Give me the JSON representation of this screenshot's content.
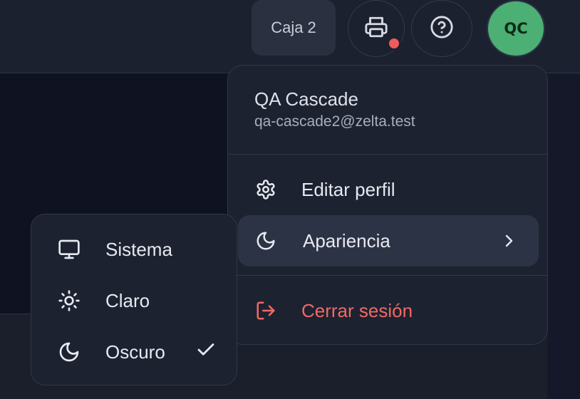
{
  "header": {
    "register_label": "Caja 2",
    "avatar_initials": "QC",
    "printer_status_color": "#ef5b5b",
    "avatar_color": "#4caf74"
  },
  "menu": {
    "user_name": "QA Cascade",
    "user_email": "qa-cascade2@zelta.test",
    "items": {
      "edit_profile": "Editar perfil",
      "appearance": "Apariencia",
      "logout": "Cerrar sesión"
    }
  },
  "appearance_submenu": {
    "options": [
      "Sistema",
      "Claro",
      "Oscuro"
    ],
    "selected": "Oscuro"
  },
  "colors": {
    "danger": "#f06a63",
    "active_bg": "#2c3345"
  }
}
